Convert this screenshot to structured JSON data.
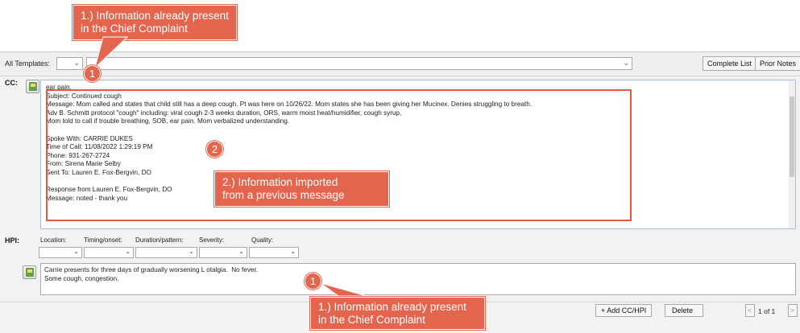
{
  "callouts": {
    "top": "1.) Information already present\nin the Chief Complaint",
    "middle": "2.) Information imported\nfrom a previous message",
    "bottom": "1.) Information already present\nin the Chief Complaint",
    "badge_top": "1",
    "badge_middle": "2",
    "badge_bottom": "1",
    "color": "#e4654e"
  },
  "toolbar": {
    "templates_label": "All Templates:",
    "complete_list": "Complete List",
    "prior_notes": "Prior Notes"
  },
  "cc": {
    "label": "CC:",
    "text": "ear pain.\nSubject: Continued cough\nMessage: Mom called and states that child still has a deep cough. Pt was here on 10/26/22. Mom states she has been giving her Mucinex. Denies struggling to breath.\nAdv B. Schmitt protocol \"cough\" including: viral cough 2-3 weeks duration, ORS, warm moist heat/humidifier, cough syrup,\nMom told to call if trouble breathing, SOB, ear pain. Mom verbalized understanding.\n\nSpoke With: CARRIE DUKES\nTime of Call: 11/08/2022 1:29:19 PM\nPhone: 931-267-2724\nFrom: Sirena Marie Selby\nSent To: Lauren E. Fox-Bergvin, DO\n\nResponse from Lauren E. Fox-Bergvin, DO\nMessage: noted - thank you"
  },
  "hpi": {
    "label": "HPI:",
    "fields": {
      "location": "Location:",
      "timing": "Timing/onset:",
      "duration": "Duration/pattern:",
      "severity": "Severity:",
      "quality": "Quality:"
    },
    "text": "Carrie presents for three days of gradually worsening L otalgia.  No fever.\nSome cough, congestion."
  },
  "bottom": {
    "add_cc_hpi": "+ Add CC/HPI",
    "delete": "Delete",
    "page": "1 of 1"
  }
}
